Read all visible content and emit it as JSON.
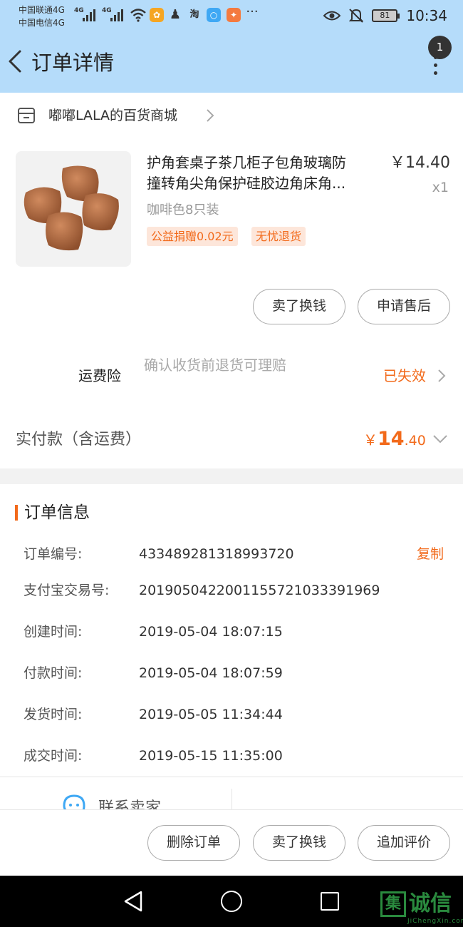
{
  "status_bar": {
    "carrier1": "中国联通4G",
    "carrier2": "中国电信4G",
    "net1": "4G",
    "net2": "4G",
    "battery": "81",
    "time": "10:34",
    "icons": [
      "signal-icon",
      "wifi-icon",
      "app-icon",
      "qq-icon",
      "taobao-icon",
      "browser-icon",
      "uc-icon",
      "more-dots-icon",
      "eye-icon",
      "mute-bell-icon",
      "battery-icon"
    ]
  },
  "header": {
    "title": "订单详情",
    "badge": "1"
  },
  "shop": {
    "name": "嘟嘟LALA的百货商城"
  },
  "product": {
    "title_line1": "护角套桌子茶几柜子包角玻璃防",
    "title_line2": "撞转角尖角保护硅胶边角床角...",
    "price": "￥14.40",
    "qty": "x1",
    "sku": "咖啡色8只装",
    "tag1": "公益捐赠0.02元",
    "tag2": "无忧退货",
    "btn_sell": "卖了换钱",
    "btn_aftersale": "申请售后"
  },
  "insurance": {
    "label": "运费险",
    "desc": "确认收货前退货可理赔",
    "status": "已失效"
  },
  "paid": {
    "label": "实付款（含运费）",
    "currency": "￥",
    "integer": "14",
    "decimal": ".40"
  },
  "order_info": {
    "title": "订单信息",
    "copy_label": "复制",
    "rows": [
      {
        "label": "订单编号:",
        "value": "433489281318993720"
      },
      {
        "label": "支付宝交易号:",
        "value": "2019050422001155721033391969"
      },
      {
        "label": "创建时间:",
        "value": "2019-05-04 18:07:15"
      },
      {
        "label": "付款时间:",
        "value": "2019-05-04 18:07:59"
      },
      {
        "label": "发货时间:",
        "value": "2019-05-05 11:34:44"
      },
      {
        "label": "成交时间:",
        "value": "2019-05-15 11:35:00"
      }
    ]
  },
  "contact": {
    "label": "联系卖家"
  },
  "actions": {
    "delete": "删除订单",
    "sell": "卖了换钱",
    "review": "追加评价"
  },
  "watermark": {
    "mark": "集",
    "text": "诚信",
    "sub": "JiChengXin.com"
  },
  "colors": {
    "header_bg": "#b5dcfa",
    "accent": "#f26a1b",
    "tag_bg": "#fde6da"
  }
}
